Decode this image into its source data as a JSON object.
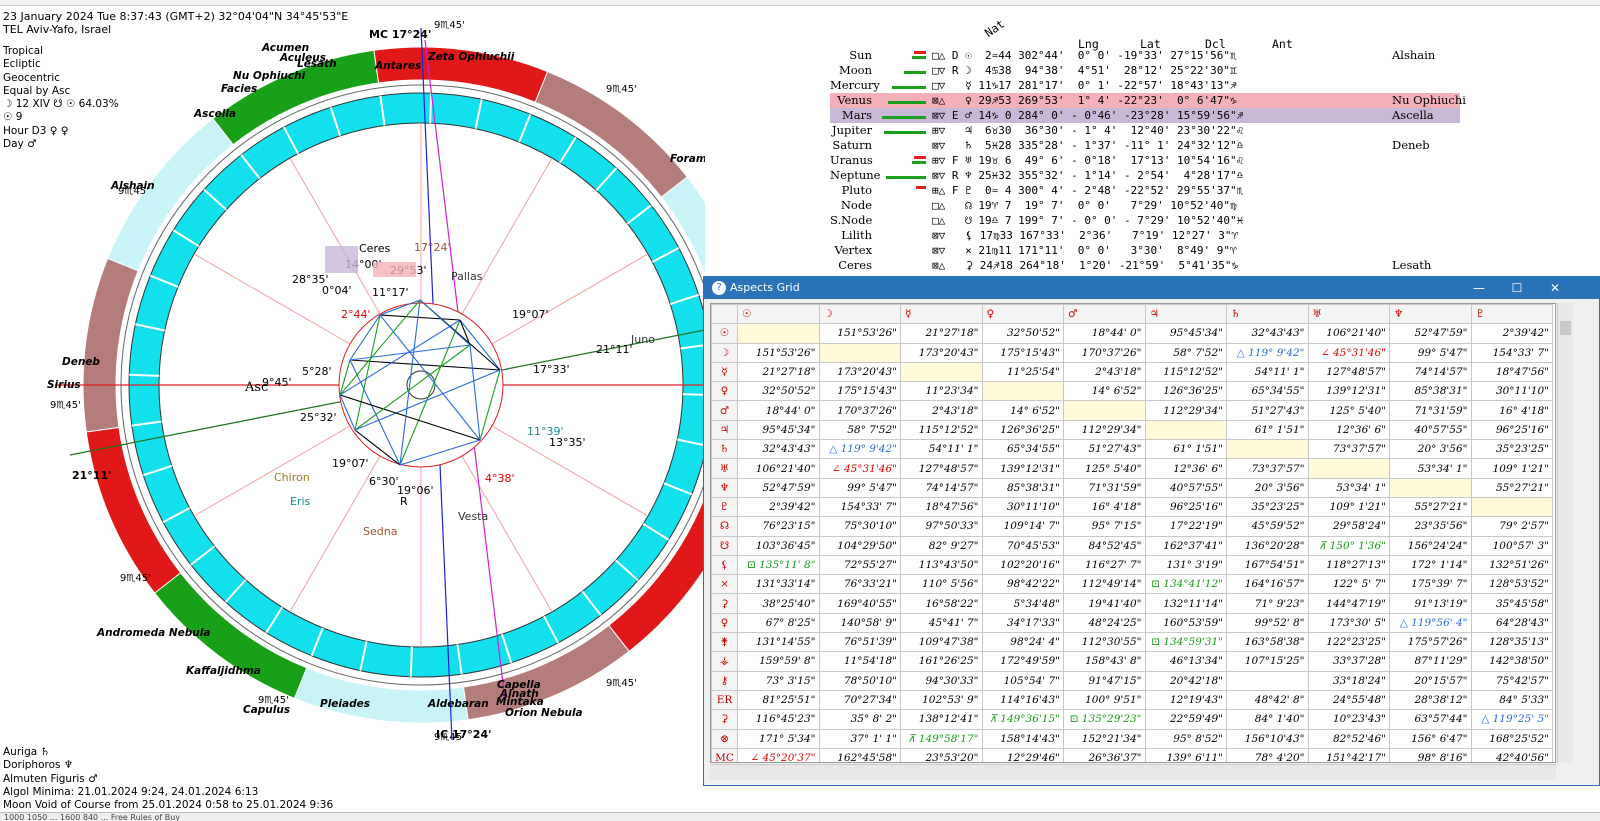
{
  "chart_info": {
    "line1": "23 January 2024   Tue     8:37:43 (GMT+2) 32°04'04\"N  34°45'53\"E",
    "line2": "TEL Aviv-Yafo, Israel",
    "settings": [
      "Tropical",
      "Ecliptic",
      "Geocentric",
      "Equal by Asc",
      "☽ 12 XIV ☋ ☉ 64.03%",
      "☉ 9",
      "Hour D3 ♀ ♀",
      "Day ♂"
    ]
  },
  "bottom_info": [
    "Auriga ♄",
    "Doriphoros ♆",
    "Almuten Figuris ♂",
    "Algol Minima: 21.01.2024  9:24,  24.01.2024  6:13",
    "Moon Void of Course from 25.01.2024  0:58 to 25.01.2024  9:36"
  ],
  "status_text": "1000 1050 ...  1600 840 ... Free Rules of Buy",
  "wheel": {
    "mc_label": "MC 17°24'",
    "ic_label": "IC 17°24'",
    "asc_label": "Asc",
    "asc_deg": "9°45'",
    "dsc_deg": "21°11'",
    "house_cusp_labels": [
      "9♏45'",
      "9♏45'",
      "9♏45'",
      "9♏45'",
      "9♏45'",
      "9♏45'",
      "9♏45'",
      "9♏45'",
      "9♏45'",
      "9♏45'"
    ],
    "planet_labels": [
      {
        "t": "Ceres",
        "c": "#000"
      },
      {
        "t": "14°00'",
        "c": "#000"
      },
      {
        "t": "17°24'",
        "c": "#a0522d"
      },
      {
        "t": "29°53'",
        "c": "#000"
      },
      {
        "t": "28°35'",
        "c": "#000"
      },
      {
        "t": "0°04'",
        "c": "#000"
      },
      {
        "t": "11°17'",
        "c": "#000"
      },
      {
        "t": "Pallas",
        "c": "#333"
      },
      {
        "t": "2°44'",
        "c": "#d00"
      },
      {
        "t": "19°07'",
        "c": "#000"
      },
      {
        "t": "5°28'",
        "c": "#000"
      },
      {
        "t": "17°33'",
        "c": "#000"
      },
      {
        "t": "21°11'",
        "c": "#000"
      },
      {
        "t": "Juno",
        "c": "#333"
      },
      {
        "t": "25°32'",
        "c": "#000"
      },
      {
        "t": "11°39'",
        "c": "#1a8a8a"
      },
      {
        "t": "13°35'",
        "c": "#000"
      },
      {
        "t": "19°07'",
        "c": "#000"
      },
      {
        "t": "4°38'",
        "c": "#d00"
      },
      {
        "t": "Chiron",
        "c": "#9a7a20"
      },
      {
        "t": "6°30'",
        "c": "#000"
      },
      {
        "t": "19°06'",
        "c": "#000"
      },
      {
        "t": "R",
        "c": "#000"
      },
      {
        "t": "Eris",
        "c": "#1a8a8a"
      },
      {
        "t": "Vesta",
        "c": "#333"
      },
      {
        "t": "Sedna",
        "c": "#a0522d"
      }
    ],
    "stars": [
      {
        "t": "Acumen"
      },
      {
        "t": "Aculeus"
      },
      {
        "t": "Lesath"
      },
      {
        "t": "Antares"
      },
      {
        "t": "Zeta Ophiuchii"
      },
      {
        "t": "Nu Ophiuchi"
      },
      {
        "t": "Facies"
      },
      {
        "t": "Ascella"
      },
      {
        "t": "Alshain"
      },
      {
        "t": "Foramen"
      },
      {
        "t": "Deneb"
      },
      {
        "t": "Sirius"
      },
      {
        "t": "Andromeda Nebula"
      },
      {
        "t": "Kaffaljidhma"
      },
      {
        "t": "Pleiades"
      },
      {
        "t": "Capulus"
      },
      {
        "t": "Aldebaran"
      },
      {
        "t": "Capella"
      },
      {
        "t": "Alnath"
      },
      {
        "t": "Mintaka"
      },
      {
        "t": "Orion Nebula"
      }
    ]
  },
  "positions": {
    "headers": {
      "nat": "Nat",
      "lng": "Lng",
      "lat": "Lat",
      "dcl": "Dcl",
      "ant": "Ant"
    },
    "rows": [
      {
        "name": "Sun",
        "cols": "□△ D ☉  2♒44 302°44'  0° 0' -19°33' 27°15'56\"♏",
        "star": "Alshain"
      },
      {
        "name": "Moon",
        "cols": "□▽ R ☽  4♋38  94°38'  4°51'  28°12' 25°22'30\"♊",
        "star": ""
      },
      {
        "name": "Mercury",
        "cols": "□▽   ☿ 11♑17 281°17'  0° 1' -22°57' 18°43'13\"♐",
        "star": ""
      },
      {
        "name": "Venus",
        "cols": "⊠△   ♀ 29♐53 269°53'  1° 4' -22°23'  0° 6'47\"♑",
        "star": "Nu Ophiuchi"
      },
      {
        "name": "Mars",
        "cols": "⊠▽ E ♂ 14♑ 0 284° 0' - 0°46' -23°28' 15°59'56\"♐",
        "star": "Ascella"
      },
      {
        "name": "Jupiter",
        "cols": "⊞▽   ♃  6♉30  36°30' - 1° 4'  12°40' 23°30'22\"♌",
        "star": ""
      },
      {
        "name": "Saturn",
        "cols": "⊠▽   ♄  5♓28 335°28' - 1°37' -11° 1' 24°32'12\"♎",
        "star": "Deneb"
      },
      {
        "name": "Uranus",
        "cols": "⊞▽ F ♅ 19♉ 6  49° 6' - 0°18'  17°13' 10°54'16\"♌",
        "star": ""
      },
      {
        "name": "Neptune",
        "cols": "⊠▽ R ♆ 25♓32 355°32' - 1°14' - 2°54'  4°28'17\"♎",
        "star": ""
      },
      {
        "name": "Pluto",
        "cols": "⊞△ F ♇  0♒ 4 300° 4' - 2°48' -22°52' 29°55'37\"♏",
        "star": ""
      },
      {
        "name": "Node",
        "cols": "□△   ☊ 19♈ 7  19° 7'  0° 0'   7°29' 10°52'40\"♍",
        "star": ""
      },
      {
        "name": "S.Node",
        "cols": "□△   ☋ 19♎ 7 199° 7' - 0° 0' - 7°29' 10°52'40\"♓",
        "star": ""
      },
      {
        "name": "Lilith",
        "cols": "⊠▽   ⚸ 17♍33 167°33'  2°36'   7°19' 12°27' 3\"♈",
        "star": ""
      },
      {
        "name": "Vertex",
        "cols": "⊠▽   × 21♍11 171°11'  0° 0'   3°30'  8°49' 9\"♈",
        "star": ""
      },
      {
        "name": "Ceres",
        "cols": "⊠△   ⚳ 24♐18 264°18'  1°20' -21°59'  5°41'35\"♑",
        "star": "Lesath"
      }
    ]
  },
  "aspects_window": {
    "title": "Aspects Grid",
    "min": "—",
    "max": "☐",
    "close": "✕",
    "col_headers": [
      "☉",
      "☽",
      "☿",
      "♀",
      "♂",
      "♃",
      "♄",
      "♅",
      "♆",
      "♇"
    ],
    "rows": [
      {
        "h": "☉",
        "c": [
          "",
          "151°53'26\"",
          "21°27'18\"",
          "32°50'52\"",
          "18°44' 0\"",
          "95°45'34\"",
          "32°43'43\"",
          "106°21'40\"",
          "52°47'59\"",
          "2°39'42\""
        ]
      },
      {
        "h": "☽",
        "c": [
          "151°53'26\"",
          "",
          "173°20'43\"",
          "175°15'43\"",
          "170°37'26\"",
          "58° 7'52\"",
          "△ 119° 9'42\"",
          "∠ 45°31'46\"",
          "99° 5'47\"",
          "154°33' 7\""
        ]
      },
      {
        "h": "☿",
        "c": [
          "21°27'18\"",
          "173°20'43\"",
          "",
          "11°25'54\"",
          "2°43'18\"",
          "115°12'52\"",
          "54°11' 1\"",
          "127°48'57\"",
          "74°14'57\"",
          "18°47'56\""
        ]
      },
      {
        "h": "♀",
        "c": [
          "32°50'52\"",
          "175°15'43\"",
          "11°23'34\"",
          "",
          "14° 6'52\"",
          "126°36'25\"",
          "65°34'55\"",
          "139°12'31\"",
          "85°38'31\"",
          "30°11'10\""
        ]
      },
      {
        "h": "♂",
        "c": [
          "18°44' 0\"",
          "170°37'26\"",
          "2°43'18\"",
          "14° 6'52\"",
          "",
          "112°29'34\"",
          "51°27'43\"",
          "125° 5'40\"",
          "71°31'59\"",
          "16° 4'18\""
        ]
      },
      {
        "h": "♃",
        "c": [
          "95°45'34\"",
          "58° 7'52\"",
          "115°12'52\"",
          "126°36'25\"",
          "112°29'34\"",
          "",
          "61° 1'51\"",
          "12°36' 6\"",
          "40°57'55\"",
          "96°25'16\""
        ]
      },
      {
        "h": "♄",
        "c": [
          "32°43'43\"",
          "△ 119° 9'42\"",
          "54°11' 1\"",
          "65°34'55\"",
          "51°27'43\"",
          "61° 1'51\"",
          "",
          "73°37'57\"",
          "20° 3'56\"",
          "35°23'25\""
        ]
      },
      {
        "h": "♅",
        "c": [
          "106°21'40\"",
          "∠ 45°31'46\"",
          "127°48'57\"",
          "139°12'31\"",
          "125° 5'40\"",
          "12°36' 6\"",
          "73°37'57\"",
          "",
          "53°34' 1\"",
          "109° 1'21\""
        ]
      },
      {
        "h": "♆",
        "c": [
          "52°47'59\"",
          "99° 5'47\"",
          "74°14'57\"",
          "85°38'31\"",
          "71°31'59\"",
          "40°57'55\"",
          "20° 3'56\"",
          "53°34' 1\"",
          "",
          "55°27'21\""
        ]
      },
      {
        "h": "♇",
        "c": [
          "2°39'42\"",
          "154°33' 7\"",
          "18°47'56\"",
          "30°11'10\"",
          "16° 4'18\"",
          "96°25'16\"",
          "35°23'25\"",
          "109° 1'21\"",
          "55°27'21\"",
          ""
        ]
      },
      {
        "h": "☊",
        "c": [
          "76°23'15\"",
          "75°30'10\"",
          "97°50'33\"",
          "109°14' 7\"",
          "95° 7'15\"",
          "17°22'19\"",
          "45°59'52\"",
          "29°58'24\"",
          "23°35'56\"",
          "79° 2'57\""
        ]
      },
      {
        "h": "☋",
        "c": [
          "103°36'45\"",
          "104°29'50\"",
          "82° 9'27\"",
          "70°45'53\"",
          "84°52'45\"",
          "162°37'41\"",
          "136°20'28\"",
          "⊼ 150° 1'36\"",
          "156°24'24\"",
          "100°57' 3\""
        ]
      },
      {
        "h": "⚸",
        "c": [
          "⊡ 135°11' 8\"",
          "72°55'27\"",
          "113°43'50\"",
          "102°20'16\"",
          "116°27' 7\"",
          "131° 3'19\"",
          "167°54'51\"",
          "118°27'13\"",
          "172° 1'14\"",
          "132°51'26\""
        ]
      },
      {
        "h": "×",
        "c": [
          "131°33'14\"",
          "76°33'21\"",
          "110° 5'56\"",
          "98°42'22\"",
          "112°49'14\"",
          "⊡ 134°41'12\"",
          "164°16'57\"",
          "122° 5' 7\"",
          "175°39' 7\"",
          "128°53'52\""
        ]
      },
      {
        "h": "⚳",
        "c": [
          "38°25'40\"",
          "169°40'55\"",
          "16°58'22\"",
          "5°34'48\"",
          "19°41'40\"",
          "132°11'14\"",
          "71° 9'23\"",
          "144°47'19\"",
          "91°13'19\"",
          "35°45'58\""
        ]
      },
      {
        "h": "♀",
        "c": [
          "67° 8'25\"",
          "140°58' 9\"",
          "45°41' 7\"",
          "34°17'33\"",
          "48°24'25\"",
          "160°53'59\"",
          "99°52' 8\"",
          "173°30' 5\"",
          "△ 119°56' 4\"",
          "64°28'43\""
        ]
      },
      {
        "h": "⚵",
        "c": [
          "131°14'55\"",
          "76°51'39\"",
          "109°47'38\"",
          "98°24' 4\"",
          "112°30'55\"",
          "⊡ 134°59'31\"",
          "163°58'38\"",
          "122°23'25\"",
          "175°57'26\"",
          "128°35'13\""
        ]
      },
      {
        "h": "⚶",
        "c": [
          "159°59' 8\"",
          "11°54'18\"",
          "161°26'25\"",
          "172°49'59\"",
          "158°43' 8\"",
          "46°13'34\"",
          "107°15'25\"",
          "33°37'28\"",
          "87°11'29\"",
          "142°38'50\""
        ]
      },
      {
        "h": "⚷",
        "c": [
          "73° 3'15\"",
          "78°50'10\"",
          "94°30'33\"",
          "105°54' 7\"",
          "91°47'15\"",
          "20°42'18\"",
          "",
          "33°18'24\"",
          "20°15'57\"",
          "75°42'57\""
        ]
      },
      {
        "h": "ER",
        "c": [
          "81°25'51\"",
          "70°27'34\"",
          "102°53' 9\"",
          "114°16'43\"",
          "100° 9'51\"",
          "12°19'43\"",
          "48°42' 8\"",
          "24°55'48\"",
          "28°38'12\"",
          "84° 5'33\""
        ]
      },
      {
        "h": "⚳",
        "c": [
          "116°45'23\"",
          "35° 8' 2\"",
          "138°12'41\"",
          "⊼ 149°36'15\"",
          "⊡ 135°29'23\"",
          "22°59'49\"",
          "84° 1'40\"",
          "10°23'43\"",
          "63°57'44\"",
          "△ 119°25' 5\""
        ]
      },
      {
        "h": "⊗",
        "c": [
          "171° 5'34\"",
          "37° 1' 1\"",
          "⊼ 149°58'17\"",
          "158°14'43\"",
          "152°21'34\"",
          "95° 8'52\"",
          "156°10'43\"",
          "82°52'46\"",
          "156° 6'47\"",
          "168°25'52\""
        ]
      },
      {
        "h": "MC",
        "c": [
          "∠ 45°20'37\"",
          "162°45'58\"",
          "23°53'20\"",
          "12°29'46\"",
          "26°36'37\"",
          "139° 6'11\"",
          "78° 4'20\"",
          "151°42'17\"",
          "98° 8'16\"",
          "42°40'56\""
        ]
      }
    ]
  }
}
